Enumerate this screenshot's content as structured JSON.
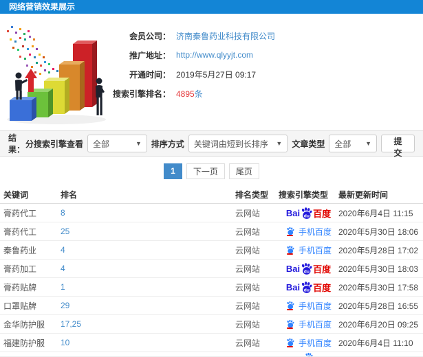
{
  "header": {
    "title": "网络营销效果展示"
  },
  "info": {
    "company_label": "会员公司：",
    "company_value": "济南秦鲁药业科技有限公司",
    "url_label": "推广地址：",
    "url_value": "http://www.qlyyjt.com",
    "open_label": "开通时间：",
    "open_value": "2019年5月27日 09:17",
    "rank_label": "搜索引擎排名：",
    "rank_value": "4895",
    "rank_suffix": "条"
  },
  "filter": {
    "result_label": "结果：",
    "engine_label": "分搜索引擎查看",
    "engine_value": "全部",
    "sort_label": "排序方式",
    "sort_value": "关键词由短到长排序",
    "article_label": "文章类型",
    "article_value": "全部",
    "submit_label": "提交"
  },
  "pagination": {
    "current": "1",
    "next": "下一页",
    "last": "尾页"
  },
  "table": {
    "headers": [
      "关键词",
      "排名",
      "排名类型",
      "搜索引擎类型",
      "最新更新时间"
    ],
    "rows": [
      {
        "keyword": "膏药代工",
        "rank": "8",
        "rank_type": "云网站",
        "engine": "baidu-pc",
        "time": "2020年6月4日 11:15"
      },
      {
        "keyword": "膏药代工",
        "rank": "25",
        "rank_type": "云网站",
        "engine": "baidu-mobile",
        "time": "2020年5月30日 18:06"
      },
      {
        "keyword": "秦鲁药业",
        "rank": "4",
        "rank_type": "云网站",
        "engine": "baidu-mobile",
        "time": "2020年5月28日 17:02"
      },
      {
        "keyword": "膏药加工",
        "rank": "4",
        "rank_type": "云网站",
        "engine": "baidu-pc",
        "time": "2020年5月30日 18:03"
      },
      {
        "keyword": "膏药贴牌",
        "rank": "1",
        "rank_type": "云网站",
        "engine": "baidu-pc",
        "time": "2020年5月30日 17:58"
      },
      {
        "keyword": "口罩贴牌",
        "rank": "29",
        "rank_type": "云网站",
        "engine": "baidu-mobile",
        "time": "2020年5月28日 16:55"
      },
      {
        "keyword": "金华防护服",
        "rank": "17,25",
        "rank_type": "云网站",
        "engine": "baidu-mobile",
        "time": "2020年6月20日 09:25"
      },
      {
        "keyword": "福建防护服",
        "rank": "10",
        "rank_type": "云网站",
        "engine": "baidu-mobile",
        "time": "2020年6月4日 11:10"
      }
    ],
    "partial_row": {
      "engine": "baidu-mobile"
    }
  },
  "engines": {
    "baidu_pc": {
      "bai": "Bai",
      "du": "du",
      "name": "百度"
    },
    "baidu_mobile": {
      "label": "手机百度"
    }
  },
  "colors": {
    "header_bg": "#1385d6",
    "link": "#428bca",
    "highlight_red": "#e4393c",
    "baidu_blue": "#2319dc",
    "baidu_red": "#e10601",
    "mobile_blue": "#3385ff",
    "active_page_bg": "#428bca"
  }
}
